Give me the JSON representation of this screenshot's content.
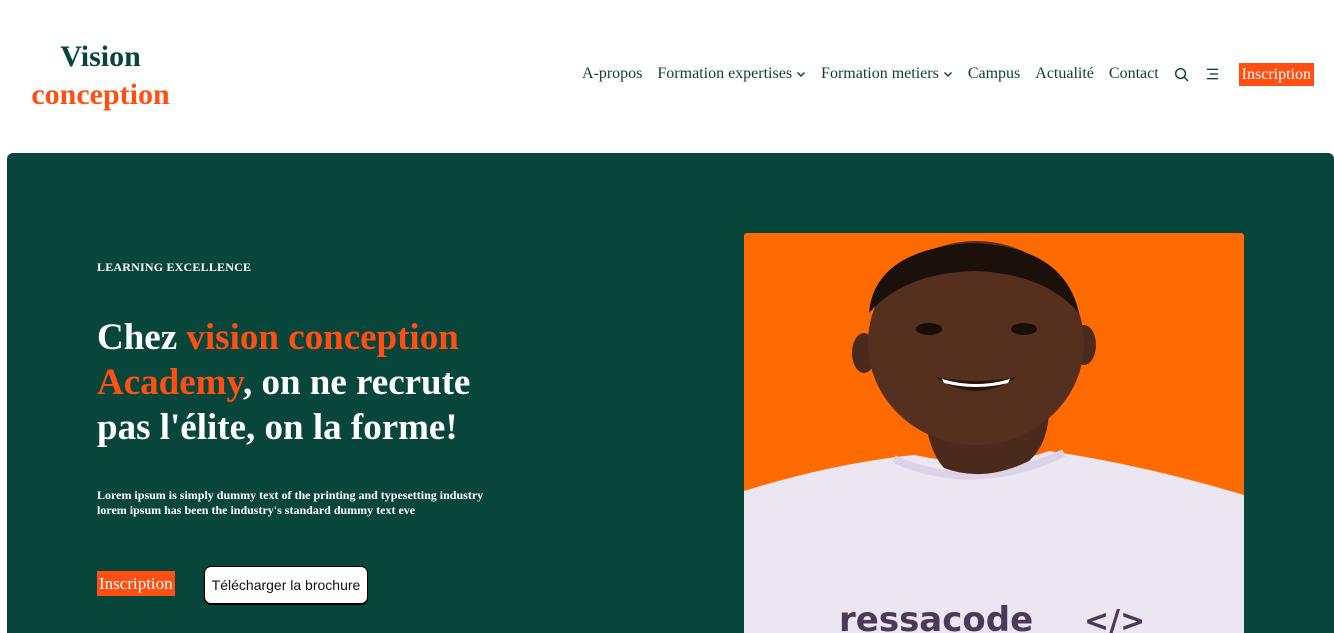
{
  "brand": {
    "line1": "Vision",
    "line2": "conception"
  },
  "nav": {
    "items": [
      {
        "label": "A-propos",
        "dropdown": false
      },
      {
        "label": "Formation expertises",
        "dropdown": true
      },
      {
        "label": "Formation metiers",
        "dropdown": true
      },
      {
        "label": "Campus",
        "dropdown": false
      },
      {
        "label": "Actualité",
        "dropdown": false
      },
      {
        "label": "Contact",
        "dropdown": false
      }
    ],
    "icons": [
      "search-icon",
      "menu-icon"
    ],
    "cta_label": "Inscription"
  },
  "hero": {
    "eyebrow": "LEARNING EXCELLENCE",
    "headline": {
      "part1": "Chez ",
      "accent": "vision conception Academy",
      "part2": ", on ne recrute pas l'élite, on la forme!"
    },
    "description": "Lorem ipsum is simply dummy text of the printing and typesetting industry lorem ipsum has been the industry's standard dummy text eve",
    "primary_button": "Inscription",
    "secondary_button": "Télécharger la brochure"
  },
  "colors": {
    "brand_green": "#08463b",
    "accent_orange": "#ff4f12",
    "photo_background": "#ff6b00"
  }
}
